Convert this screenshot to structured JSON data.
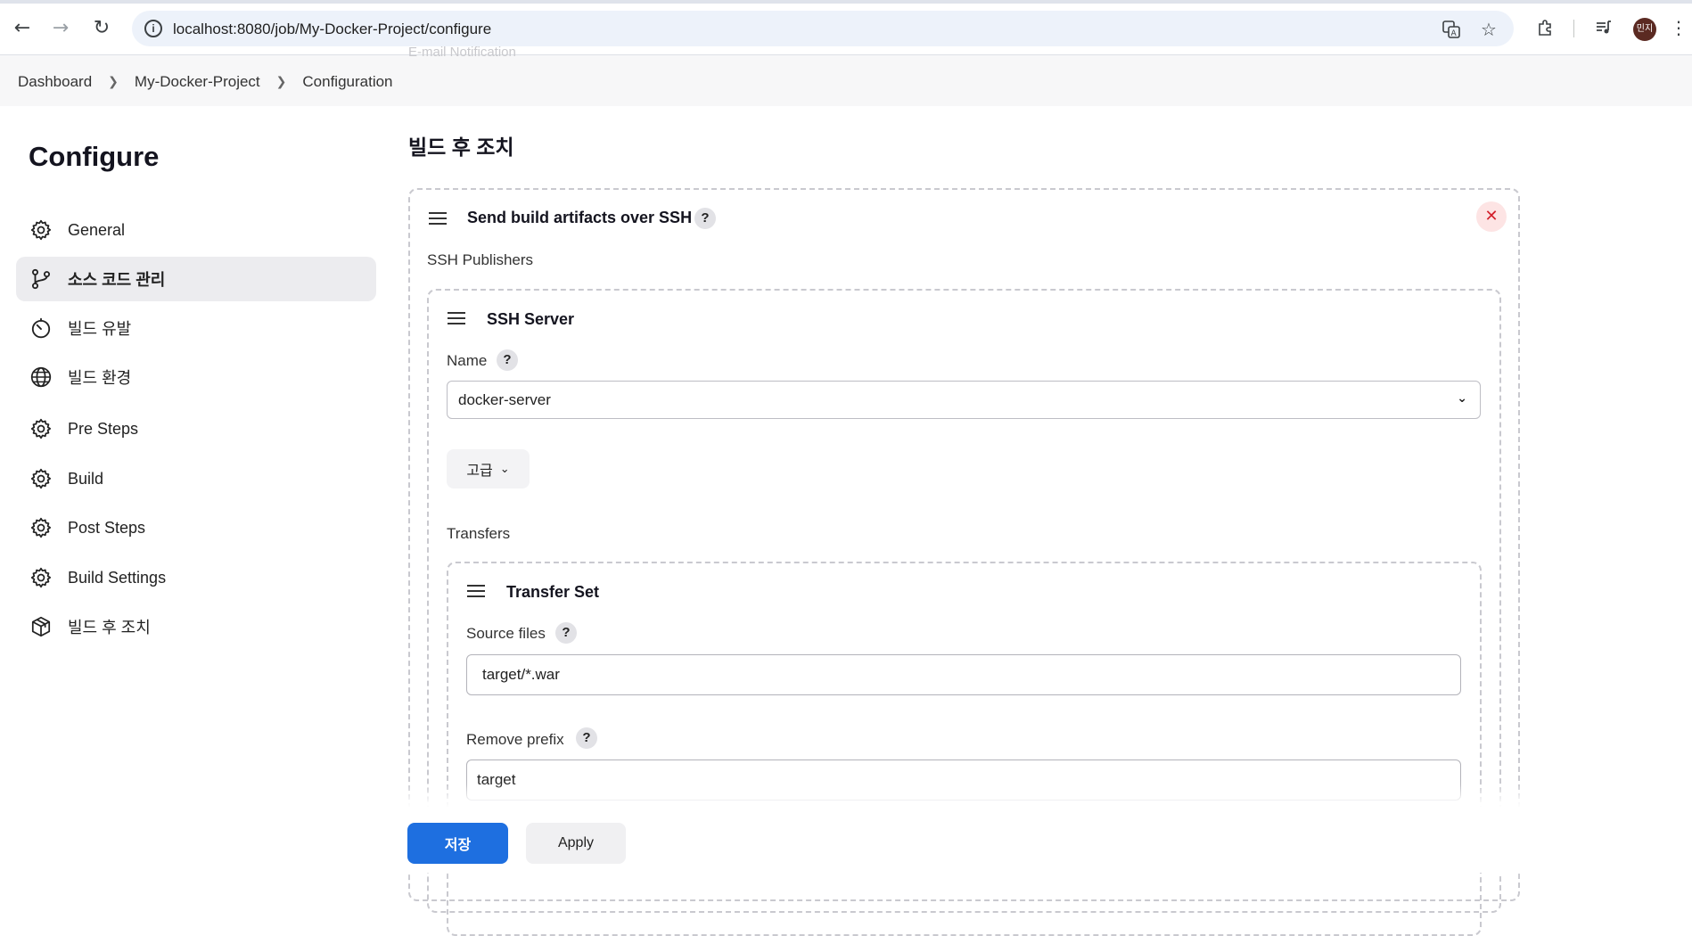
{
  "browser": {
    "url": "localhost:8080/job/My-Docker-Project/configure",
    "avatar_text": "민지"
  },
  "breadcrumb": [
    "Dashboard",
    "My-Docker-Project",
    "Configuration"
  ],
  "ghost_text": "E-mail Notification",
  "sidebar": {
    "title": "Configure",
    "items": [
      {
        "label": "General",
        "icon": "gear-icon"
      },
      {
        "label": "소스 코드 관리",
        "icon": "branch-icon",
        "active": true
      },
      {
        "label": "빌드 유발",
        "icon": "timer-icon"
      },
      {
        "label": "빌드 환경",
        "icon": "globe-icon"
      },
      {
        "label": "Pre Steps",
        "icon": "gear-icon"
      },
      {
        "label": "Build",
        "icon": "gear-icon"
      },
      {
        "label": "Post Steps",
        "icon": "gear-icon"
      },
      {
        "label": "Build Settings",
        "icon": "gear-icon"
      },
      {
        "label": "빌드 후 조치",
        "icon": "package-icon"
      }
    ]
  },
  "main": {
    "section_title": "빌드 후 조치",
    "publisher": {
      "title": "Send build artifacts over SSH",
      "help": "?",
      "ssh_publishers_label": "SSH Publishers",
      "server": {
        "title": "SSH Server",
        "name_label": "Name",
        "name_value": "docker-server",
        "advanced_label": "고급",
        "transfers_label": "Transfers",
        "transfer_set": {
          "title": "Transfer Set",
          "source_files_label": "Source files",
          "source_files_value": "target/*.war",
          "remove_prefix_label": "Remove prefix",
          "remove_prefix_value": "target"
        }
      }
    }
  },
  "footer": {
    "save_label": "저장",
    "apply_label": "Apply"
  }
}
